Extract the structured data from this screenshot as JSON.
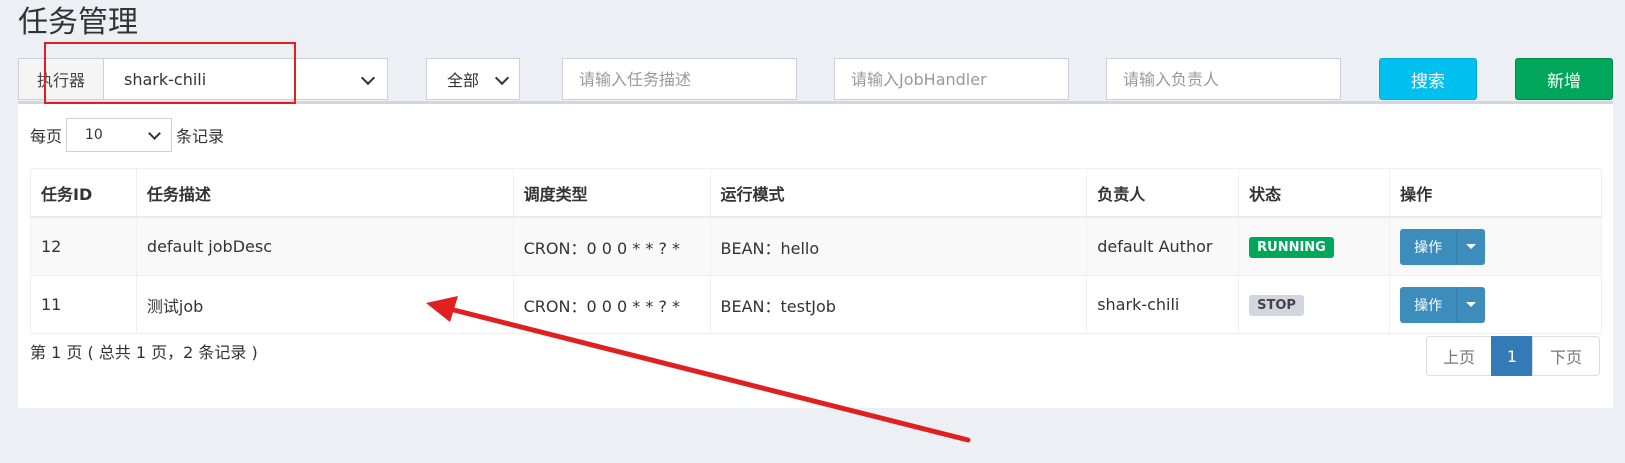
{
  "title": "任务管理",
  "filters": {
    "executor_label": "执行器",
    "executor_value": "shark-chili",
    "status_value": "全部",
    "desc_placeholder": "请输入任务描述",
    "handler_placeholder": "请输入JobHandler",
    "author_placeholder": "请输入负责人",
    "search_label": "搜索",
    "add_label": "新增"
  },
  "page_size": {
    "prefix": "每页",
    "value": "10",
    "suffix": "条记录"
  },
  "table": {
    "headers": [
      "任务ID",
      "任务描述",
      "调度类型",
      "运行模式",
      "负责人",
      "状态",
      "操作"
    ],
    "rows": [
      {
        "id": "12",
        "desc": "default jobDesc",
        "schedule": "CRON：0 0 0 * * ? *",
        "mode": "BEAN：hello",
        "author": "default Author",
        "status": "RUNNING",
        "op": "操作"
      },
      {
        "id": "11",
        "desc": "测试job",
        "schedule": "CRON：0 0 0 * * ? *",
        "mode": "BEAN：testJob",
        "author": "shark-chili",
        "status": "STOP",
        "op": "操作"
      }
    ]
  },
  "summary": "第 1 页 ( 总共 1 页，2 条记录 )",
  "pagination": {
    "prev": "上页",
    "current": "1",
    "next": "下页"
  },
  "colors": {
    "search": "#00c0ef",
    "add": "#00a65a",
    "running": "#00a65a",
    "op": "#3c8dbc",
    "annotation": "#e02020"
  }
}
